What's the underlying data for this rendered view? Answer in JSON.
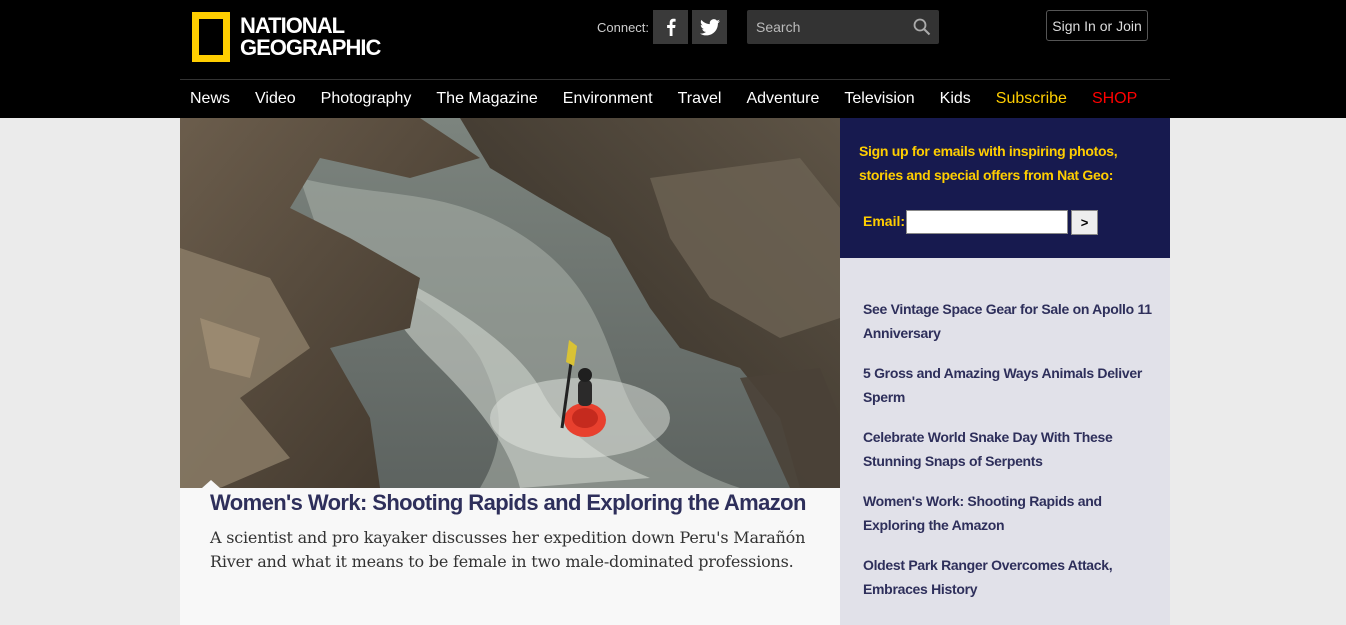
{
  "header": {
    "logo_line1": "NATIONAL",
    "logo_line2": "GEOGRAPHIC",
    "connect_label": "Connect:",
    "social_icons": [
      "facebook-icon",
      "twitter-icon"
    ],
    "search_placeholder": "Search",
    "signin_label": "Sign In or Join"
  },
  "nav": {
    "items": [
      "News",
      "Video",
      "Photography",
      "The Magazine",
      "Environment",
      "Travel",
      "Adventure",
      "Television",
      "Kids"
    ],
    "subscribe": "Subscribe",
    "shop": "SHOP"
  },
  "feature": {
    "headline": "Women's Work: Shooting Rapids and Exploring the Amazon",
    "dek": "A scientist and pro kayaker discusses her expedition down Peru's Marañón River and what it means to be female in two male-dominated professions."
  },
  "signup": {
    "text": "Sign up for emails with inspiring photos, stories and special offers from Nat Geo:",
    "email_label": "Email:",
    "submit_label": ">"
  },
  "sidebar_links": [
    "See Vintage Space Gear for Sale on Apollo 11 Anniversary",
    "5 Gross and Amazing Ways Animals Deliver Sperm",
    "Celebrate World Snake Day With These Stunning Snaps of Serpents",
    "Women's Work: Shooting Rapids and Exploring the Amazon",
    "Oldest Park Ranger Overcomes Attack, Embraces History"
  ],
  "colors": {
    "brand_yellow": "#ffce00",
    "shop_red": "#ff0000",
    "navy": "#171a4f",
    "link_navy": "#2e2f5b"
  }
}
